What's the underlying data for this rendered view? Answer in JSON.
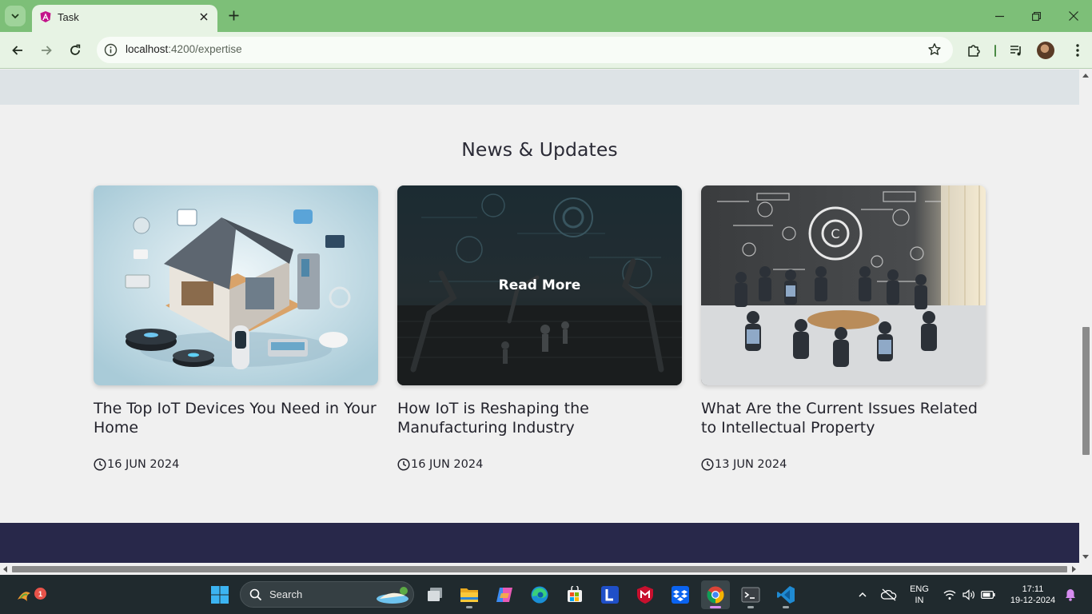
{
  "browser": {
    "tab_title": "Task",
    "url_host": "localhost",
    "url_path": ":4200/expertise",
    "icons": [
      "tab-search-icon",
      "angular-favicon-icon",
      "close-icon",
      "plus-icon",
      "minimize-icon",
      "restore-icon",
      "close-window-icon",
      "back-arrow-icon",
      "forward-arrow-icon",
      "reload-icon",
      "site-info-icon",
      "bookmark-star-icon",
      "extensions-icon",
      "media-control-icon",
      "profile-avatar",
      "more-menu-icon"
    ]
  },
  "page": {
    "section_title": "News & Updates",
    "cards": [
      {
        "title": "The Top IoT Devices You Need in Your Home",
        "date": "16 JUN 2024",
        "image": "smart-home-iot-devices-illustration"
      },
      {
        "title": "How IoT is Reshaping the Manufacturing Industry",
        "date": "16 JUN 2024",
        "image": "robotic-factory-illustration",
        "overlay_label": "Read More"
      },
      {
        "title": "What Are the Current Issues Related to Intellectual Property",
        "date": "13 JUN 2024",
        "image": "meeting-copyright-illustration"
      }
    ],
    "colors": {
      "footer": "#28284a",
      "top_band": "#dde3e6",
      "background": "#f0f0f0"
    }
  },
  "taskbar": {
    "search_label": "Search",
    "notification_count": "1",
    "language_line1": "ENG",
    "language_line2": "IN",
    "time": "17:11",
    "date": "19-12-2024",
    "apps": [
      "task-view",
      "file-explorer",
      "copilot",
      "edge",
      "microsoft-store",
      "launcher-l",
      "mcafee",
      "dropbox",
      "chrome",
      "terminal",
      "vscode"
    ]
  }
}
